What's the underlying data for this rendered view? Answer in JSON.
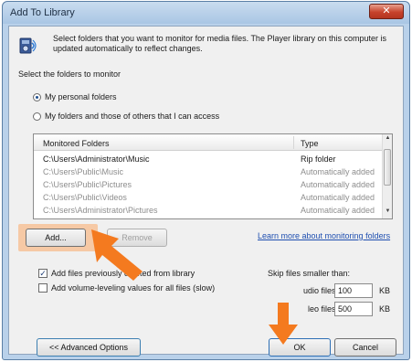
{
  "window": {
    "title": "Add To Library",
    "close_glyph": "✕"
  },
  "description": "Select folders that you want to monitor for media files. The Player library on this computer is updated automatically to reflect changes.",
  "select_label": "Select the folders to monitor",
  "radio_options": [
    {
      "label": "My personal folders",
      "selected": true
    },
    {
      "label": "My folders and those of others that I can access",
      "selected": false
    }
  ],
  "folders_table": {
    "columns": [
      "Monitored Folders",
      "Type"
    ],
    "rows": [
      {
        "folder": "C:\\Users\\Administrator\\Music",
        "type": "Rip folder"
      },
      {
        "folder": "C:\\Users\\Public\\Music",
        "type": "Automatically added"
      },
      {
        "folder": "C:\\Users\\Public\\Pictures",
        "type": "Automatically added"
      },
      {
        "folder": "C:\\Users\\Public\\Videos",
        "type": "Automatically added"
      },
      {
        "folder": "C:\\Users\\Administrator\\Pictures",
        "type": "Automatically added"
      }
    ]
  },
  "buttons": {
    "add": "Add...",
    "remove": "Remove",
    "advanced": "<< Advanced Options",
    "ok": "OK",
    "cancel": "Cancel"
  },
  "learn_more_link": "Learn more about monitoring folders",
  "checkboxes": [
    {
      "label": "Add files previously deleted from library",
      "checked": true
    },
    {
      "label": "Add volume-leveling values for all files (slow)",
      "checked": false
    }
  ],
  "skip_label": "Skip files smaller than:",
  "size_fields": [
    {
      "label": "udio files:",
      "value": "100",
      "unit": "KB"
    },
    {
      "label": "leo files:",
      "value": "500",
      "unit": "KB"
    }
  ],
  "colors": {
    "arrow": "#f47a1f",
    "highlight": "#f6c9a5",
    "link": "#1f4fb0"
  },
  "icons": [
    "library-speaker-icon",
    "pointer-arrow-icon"
  ]
}
